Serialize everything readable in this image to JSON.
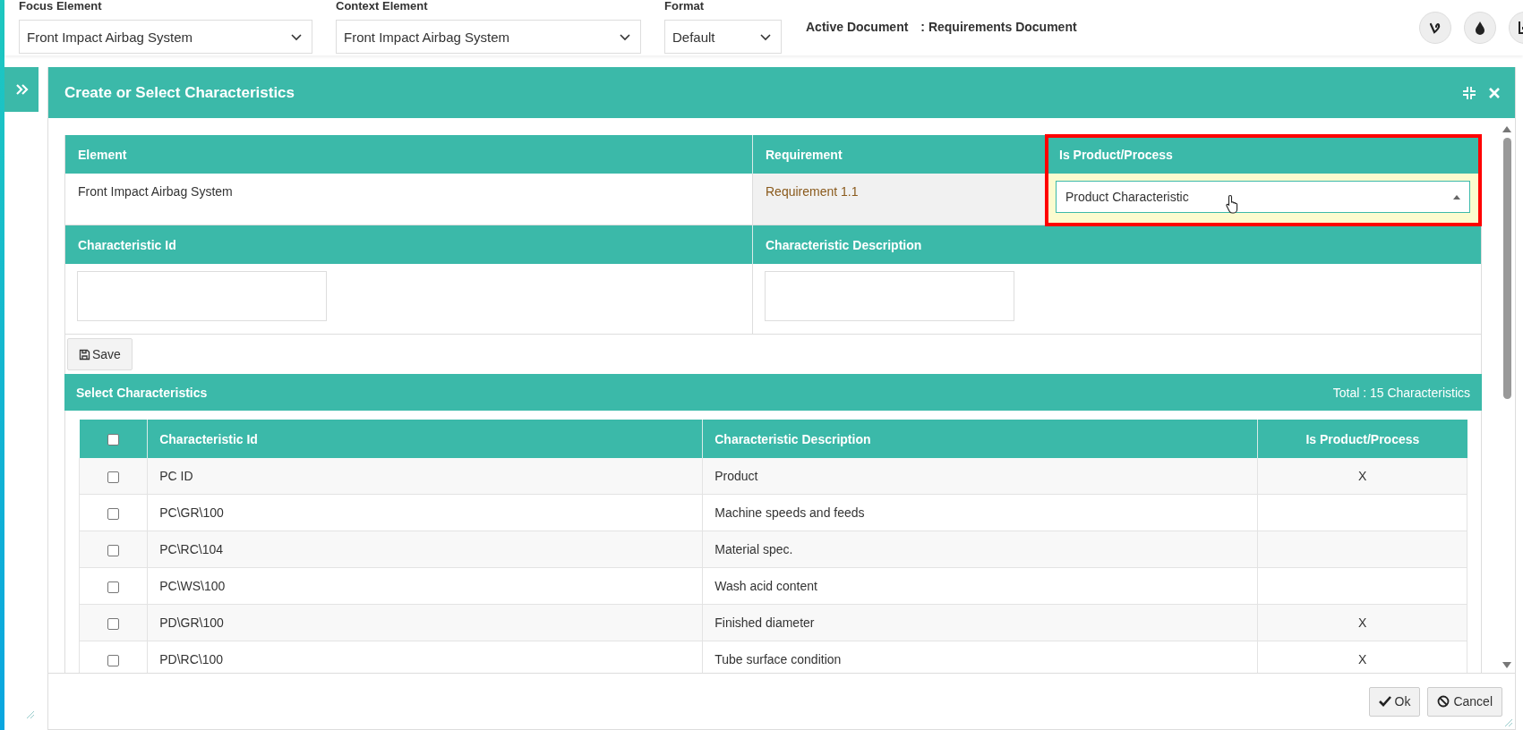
{
  "topbar": {
    "fields": [
      {
        "label": "Focus Element",
        "value": "Front Impact Airbag System"
      },
      {
        "label": "Context Element",
        "value": "Front Impact Airbag System"
      },
      {
        "label": "Format",
        "value": "Default"
      }
    ],
    "active_document": {
      "label": "Active Document",
      "value": ": Requirements Document"
    },
    "tool_buttons": [
      {
        "kind": "vine"
      },
      {
        "kind": "drop"
      },
      {
        "kind": "chart"
      }
    ]
  },
  "dialog": {
    "title": "Create or Select Characteristics",
    "form": {
      "element": {
        "header": "Element",
        "value": "Front Impact Airbag System"
      },
      "requirement": {
        "header": "Requirement",
        "value": "Requirement 1.1"
      },
      "type": {
        "header": "Is Product/Process",
        "value": "Product Characteristic",
        "highlighted": true
      },
      "characteristic_id": {
        "header": "Characteristic Id"
      },
      "characteristic_description": {
        "header": "Characteristic Description"
      }
    },
    "save_button": "Save",
    "list": {
      "title": "Select Characteristics",
      "total": "Total : 15 Characteristics",
      "select_all": {
        "checked": false
      },
      "columns": [
        "Characteristic Id",
        "Characteristic Description",
        "Is Product/Process"
      ],
      "rows": [
        {
          "checked": false,
          "id": "PC ID",
          "description": "Product",
          "flag": "X"
        },
        {
          "checked": false,
          "id": "PC\\GR\\100",
          "description": "Machine speeds and feeds"
        },
        {
          "checked": false,
          "id": "PC\\RC\\104",
          "description": "Material spec."
        },
        {
          "checked": false,
          "id": "PC\\WS\\100",
          "description": "Wash acid content"
        },
        {
          "checked": false,
          "id": "PD\\GR\\100",
          "description": "Finished diameter",
          "flag": "X"
        },
        {
          "checked": false,
          "id": "PD\\RC\\100",
          "description": "Tube surface condition",
          "flag": "X"
        }
      ]
    },
    "buttons": [
      {
        "kind": "ok",
        "label": "Ok"
      },
      {
        "kind": "cancel",
        "label": "Cancel"
      }
    ]
  }
}
